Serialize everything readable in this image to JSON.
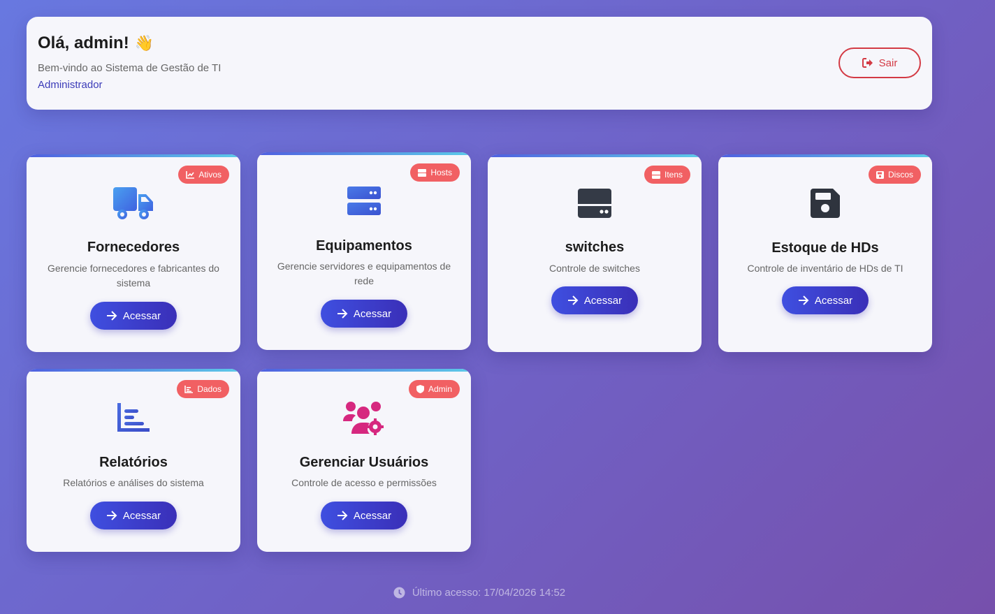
{
  "header": {
    "greeting": "Olá, admin!",
    "wave_emoji": "👋",
    "subtitle": "Bem-vindo ao Sistema de Gestão de TI",
    "role": "Administrador",
    "logout_label": "Sair"
  },
  "cards": [
    {
      "title": "Fornecedores",
      "description": "Gerencie fornecedores e fabricantes do sistema",
      "badge": "Ativos",
      "badge_icon": "chart-line-icon",
      "icon": "truck-icon",
      "button": "Acessar"
    },
    {
      "title": "Equipamentos",
      "description": "Gerencie servidores e equipamentos de rede",
      "badge": "Hosts",
      "badge_icon": "server-icon",
      "icon": "server-icon",
      "button": "Acessar"
    },
    {
      "title": "switches",
      "description": "Controle de switches",
      "badge": "Itens",
      "badge_icon": "hdd-icon",
      "icon": "switch-icon",
      "button": "Acessar"
    },
    {
      "title": "Estoque de HDs",
      "description": "Controle de inventário de HDs de TI",
      "badge": "Discos",
      "badge_icon": "floppy-icon",
      "icon": "floppy-disk-icon",
      "button": "Acessar"
    },
    {
      "title": "Relatórios",
      "description": "Relatórios e análises do sistema",
      "badge": "Dados",
      "badge_icon": "chart-bar-icon",
      "icon": "bar-chart-icon",
      "button": "Acessar"
    },
    {
      "title": "Gerenciar Usuários",
      "description": "Controle de acesso e permissões",
      "badge": "Admin",
      "badge_icon": "shield-icon",
      "icon": "users-cog-icon",
      "button": "Acessar"
    }
  ],
  "footer": {
    "last_access": "Último acesso: 17/04/2026 14:52"
  },
  "colors": {
    "accent": "#3f4fe0",
    "badge": "#f16063",
    "logout": "#d33a44",
    "users_icon": "#d6287f"
  }
}
